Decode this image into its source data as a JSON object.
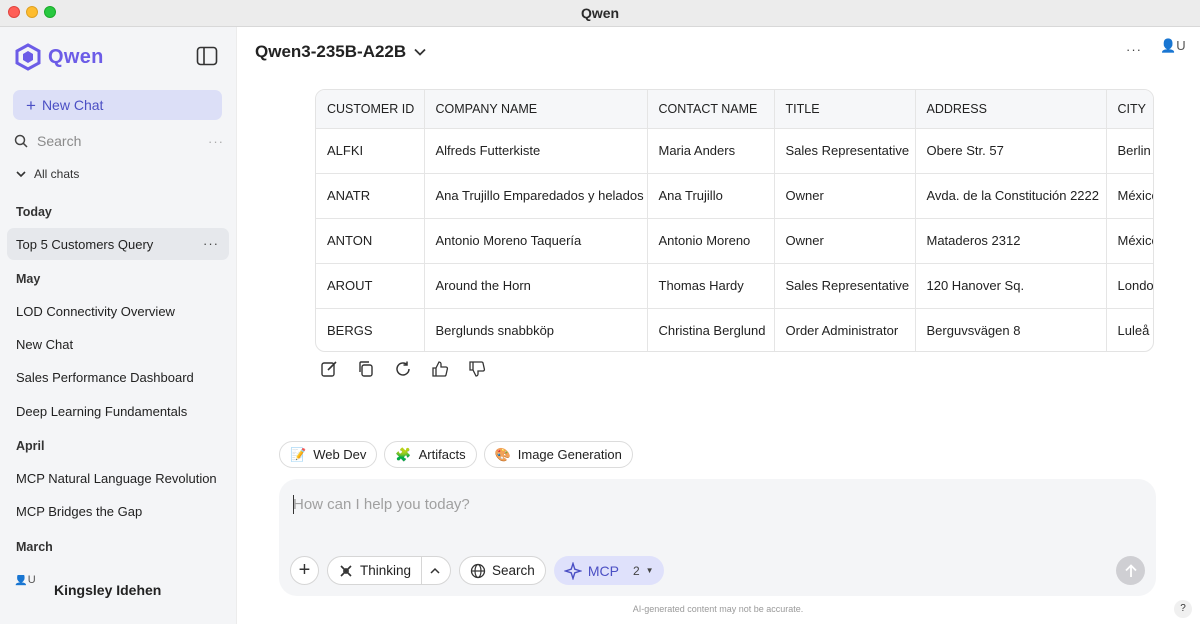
{
  "window": {
    "title": "Qwen"
  },
  "sidebar": {
    "brand": "Qwen",
    "new_chat": "New Chat",
    "search_label": "Search",
    "all_chats": "All chats",
    "groups": {
      "today": {
        "label": "Today",
        "items": [
          {
            "label": "Top 5 Customers Query"
          }
        ]
      },
      "may": {
        "label": "May",
        "items": [
          {
            "label": "LOD Connectivity Overview"
          },
          {
            "label": "New Chat"
          },
          {
            "label": "Sales Performance Dashboard"
          },
          {
            "label": "Deep Learning Fundamentals"
          }
        ]
      },
      "april": {
        "label": "April",
        "items": [
          {
            "label": "MCP Natural Language Revolution"
          },
          {
            "label": "MCP Bridges the Gap"
          }
        ]
      },
      "march": {
        "label": "March"
      }
    },
    "user": {
      "avatar_alt": "U",
      "name": "Kingsley Idehen"
    }
  },
  "header": {
    "model": "Qwen3-235B-A22B",
    "avatar_alt": "U"
  },
  "table": {
    "headers": [
      "CUSTOMER ID",
      "COMPANY NAME",
      "CONTACT NAME",
      "TITLE",
      "ADDRESS",
      "CITY"
    ],
    "rows": [
      [
        "ALFKI",
        "Alfreds Futterkiste",
        "Maria Anders",
        "Sales Representative",
        "Obere Str. 57",
        "Berlin"
      ],
      [
        "ANATR",
        "Ana Trujillo Emparedados y helados",
        "Ana Trujillo",
        "Owner",
        "Avda. de la Constitución 2222",
        "México D.F."
      ],
      [
        "ANTON",
        "Antonio Moreno Taquería",
        "Antonio Moreno",
        "Owner",
        "Mataderos 2312",
        "México D.F."
      ],
      [
        "AROUT",
        "Around the Horn",
        "Thomas Hardy",
        "Sales Representative",
        "120 Hanover Sq.",
        "London"
      ],
      [
        "BERGS",
        "Berglunds snabbköp",
        "Christina Berglund",
        "Order Administrator",
        "Berguvsvägen 8",
        "Luleå"
      ]
    ]
  },
  "chips": {
    "web_dev": "Web Dev",
    "artifacts": "Artifacts",
    "image_generation": "Image Generation"
  },
  "composer": {
    "placeholder": "How can I help you today?",
    "thinking": "Thinking",
    "search": "Search",
    "mcp": "MCP",
    "mcp_count": "2"
  },
  "footer": {
    "disclaimer": "AI-generated content may not be accurate.",
    "help": "?"
  },
  "colors": {
    "accent": "#6c5ce7",
    "accent_bg": "#dcdff7",
    "sidebar_bg": "#f4f5f7"
  }
}
